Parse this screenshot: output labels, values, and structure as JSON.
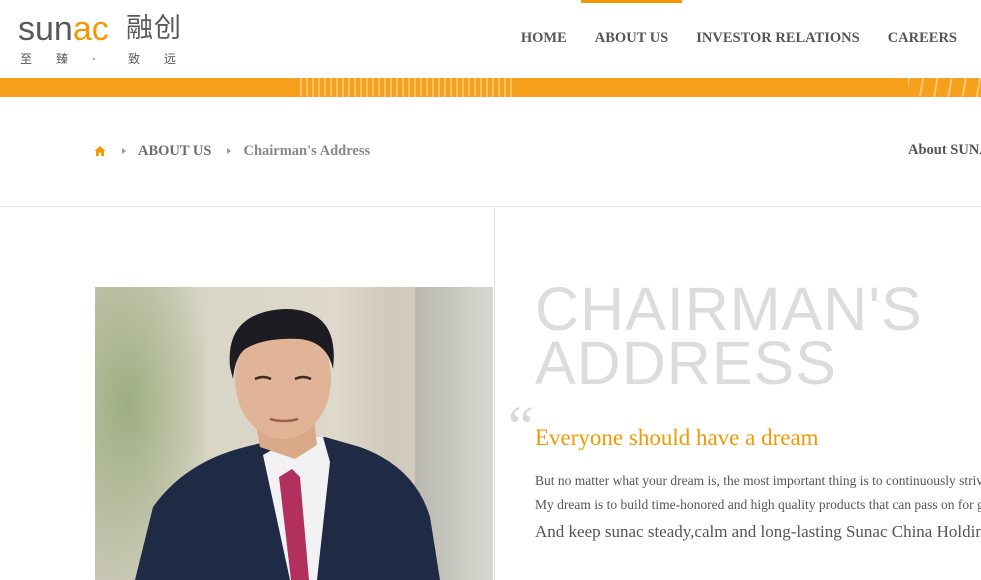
{
  "header": {
    "logo": {
      "en_prefix": "sun",
      "en_accent": "ac",
      "cn": "融创",
      "tagline": [
        "至",
        "臻",
        "·",
        "致",
        "远"
      ]
    },
    "nav": [
      {
        "label": "HOME",
        "active": false
      },
      {
        "label": "ABOUT US",
        "active": true
      },
      {
        "label": "INVESTOR RELATIONS",
        "active": false
      },
      {
        "label": "CAREERS",
        "active": false
      }
    ]
  },
  "colors": {
    "accent": "#f39800",
    "bar": "#f7a01c"
  },
  "breadcrumb": {
    "home_icon": "home-icon",
    "items": [
      "ABOUT US",
      "Chairman's Address"
    ],
    "side_link": "About SUNAC"
  },
  "content": {
    "title": "CHAIRMAN'S\nADDRESS",
    "quote_mark": "“",
    "headline": "Everyone should have a dream",
    "paragraphs": [
      "But no matter what your dream is, the most important thing is to continuously strive for it.",
      "My dream is to build time-honored and high quality products that can pass on for generations.",
      "And keep sunac steady,calm and long-lasting Sunac China Holdings"
    ]
  }
}
